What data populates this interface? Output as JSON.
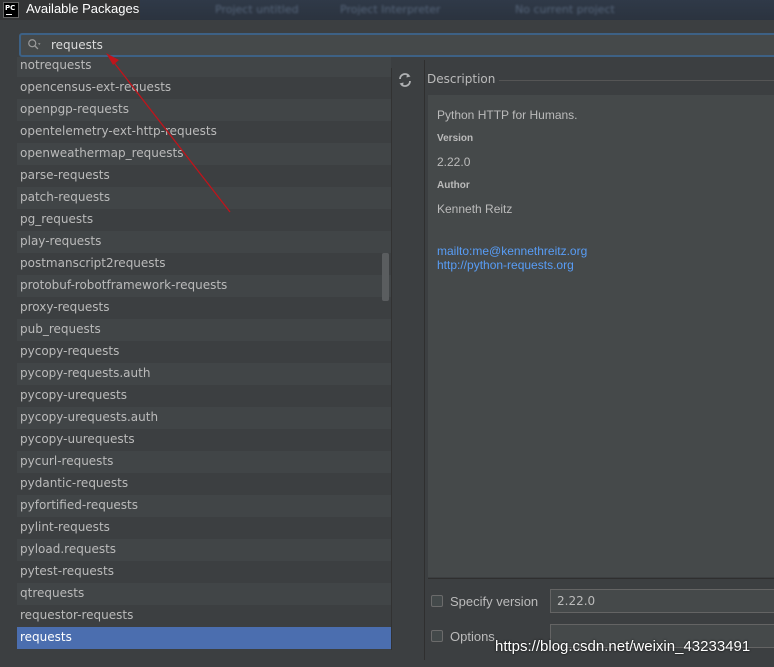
{
  "window": {
    "title": "Available Packages",
    "app_icon_text": "PC",
    "bg_tabs": [
      "Project untitled",
      "Project Interpreter",
      "No current project"
    ]
  },
  "search": {
    "value": "requests",
    "icon": "search-icon"
  },
  "packages": [
    "notrequests",
    "opencensus-ext-requests",
    "openpgp-requests",
    "opentelemetry-ext-http-requests",
    "openweathermap_requests",
    "parse-requests",
    "patch-requests",
    "pg_requests",
    "play-requests",
    "postmanscript2requests",
    "protobuf-robotframework-requests",
    "proxy-requests",
    "pub_requests",
    "pycopy-requests",
    "pycopy-requests.auth",
    "pycopy-urequests",
    "pycopy-urequests.auth",
    "pycopy-uurequests",
    "pycurl-requests",
    "pydantic-requests",
    "pyfortified-requests",
    "pylint-requests",
    "pyload.requests",
    "pytest-requests",
    "qtrequests",
    "requestor-requests",
    "requests"
  ],
  "selected_package": "requests",
  "description": {
    "header": "Description",
    "summary": "Python HTTP for Humans.",
    "version_label": "Version",
    "version": "2.22.0",
    "author_label": "Author",
    "author": "Kenneth Reitz",
    "email_link": "mailto:me@kennethreitz.org",
    "homepage_link": "http://python-requests.org"
  },
  "options": {
    "specify_version_label": "Specify version",
    "specify_version_value": "2.22.0",
    "specify_version_checked": false,
    "options_label": "Options",
    "options_value": "",
    "options_checked": false
  },
  "watermark": "https://blog.csdn.net/weixin_43233491",
  "colors": {
    "selection": "#4b6eaf",
    "link": "#589df6",
    "background": "#3c3f41",
    "annotation_arrow": "#c0141b"
  }
}
